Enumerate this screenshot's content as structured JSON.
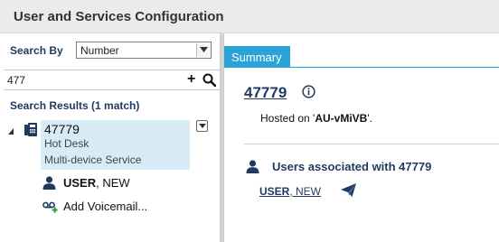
{
  "window": {
    "title": "User and Services Configuration"
  },
  "search": {
    "by_label": "Search By",
    "by_value": "Number",
    "query": "477",
    "results_label": "Search Results (1 match)"
  },
  "tree": {
    "node": {
      "number": "47779",
      "line2": "Hot Desk",
      "line3": "Multi-device Service"
    },
    "user": {
      "last": "USER",
      "first": ", NEW"
    },
    "add_voicemail": "Add Voicemail..."
  },
  "summary": {
    "tab_label": "Summary",
    "number": "47779",
    "hosted_prefix": "Hosted on '",
    "hosted_name": "AU-vMiVB",
    "hosted_suffix": "'.",
    "users_title": "Users associated with 47779",
    "user_last": "USER",
    "user_first": ", NEW"
  },
  "colors": {
    "accent": "#2aa3d9",
    "heading": "#1f3a5f",
    "selection": "#d7ecf7"
  },
  "icons": [
    "phone-icon",
    "user-icon",
    "voicemail-add-icon",
    "info-icon",
    "users-icon",
    "send-icon",
    "search-icon",
    "plus-icon",
    "chevron-down-icon",
    "caret-expanded-icon"
  ]
}
